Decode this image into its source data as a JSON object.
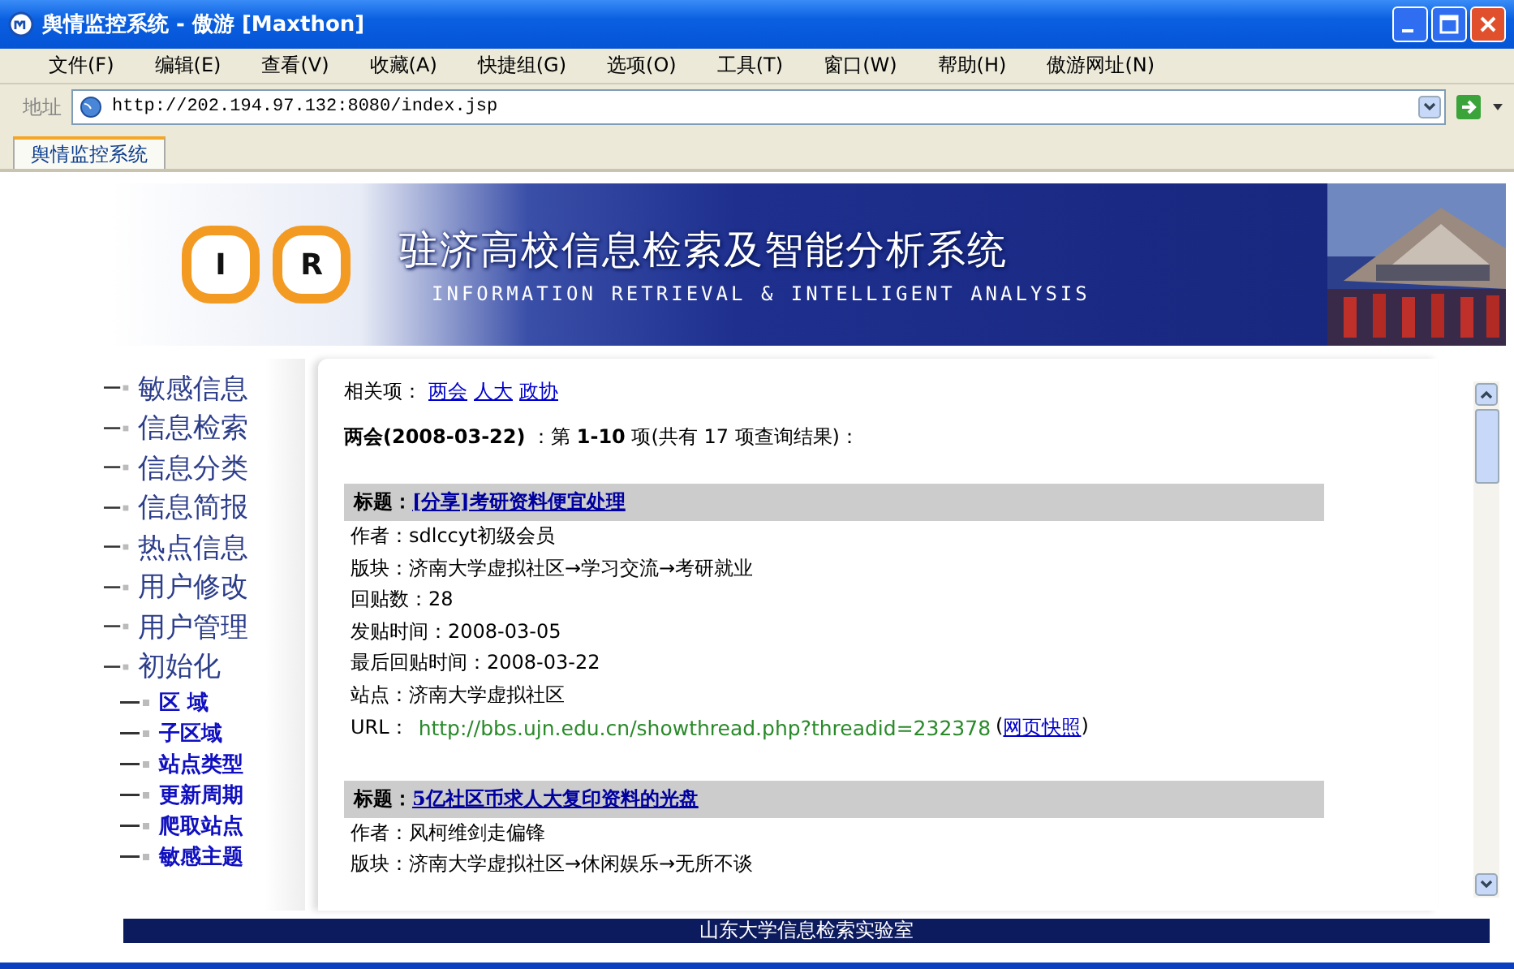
{
  "window": {
    "title": "舆情监控系统 - 傲游 [Maxthon]"
  },
  "menu": [
    "文件(F)",
    "编辑(E)",
    "查看(V)",
    "收藏(A)",
    "快捷组(G)",
    "选项(O)",
    "工具(T)",
    "窗口(W)",
    "帮助(H)",
    "傲游网址(N)"
  ],
  "address_bar": {
    "label": "地址",
    "value": "http://202.194.97.132:8080/index.jsp"
  },
  "tabs": [
    {
      "label": "舆情监控系统",
      "selected": true
    }
  ],
  "banner": {
    "logo_letters": [
      "I",
      "R"
    ],
    "title": "驻济高校信息检索及智能分析系统",
    "subtitle": "INFORMATION RETRIEVAL & INTELLIGENT ANALYSIS"
  },
  "sidebar": {
    "items": [
      {
        "label": "敏感信息",
        "kind": "main"
      },
      {
        "label": "信息检索",
        "kind": "main"
      },
      {
        "label": "信息分类",
        "kind": "main"
      },
      {
        "label": "信息简报",
        "kind": "main"
      },
      {
        "label": "热点信息",
        "kind": "main"
      },
      {
        "label": "用户修改",
        "kind": "main"
      },
      {
        "label": "用户管理",
        "kind": "main"
      },
      {
        "label": "初始化",
        "kind": "main"
      },
      {
        "label": "区  域",
        "kind": "sub"
      },
      {
        "label": "子区域",
        "kind": "sub"
      },
      {
        "label": "站点类型",
        "kind": "sub"
      },
      {
        "label": "更新周期",
        "kind": "sub"
      },
      {
        "label": "爬取站点",
        "kind": "sub"
      },
      {
        "label": "敏感主题",
        "kind": "sub"
      }
    ]
  },
  "related": {
    "label": "相关项：",
    "links": [
      "两会",
      "人大",
      "政协"
    ]
  },
  "summary": "**两会(2008-03-22)** ：第 **1-10** 项(共有  17 项查询结果)：",
  "results": [
    {
      "title_label": "标题：",
      "title": "[分享]考研资料便宜处理",
      "fields": [
        {
          "label": "作者：",
          "value": "sdlccyt初级会员"
        },
        {
          "label": "版块：",
          "value": "济南大学虚拟社区→学习交流→考研就业"
        },
        {
          "label": "回贴数：",
          "value": "28"
        },
        {
          "label": "发贴时间：",
          "value": "2008-03-05"
        },
        {
          "label": "最后回贴时间：",
          "value": "2008-03-22"
        },
        {
          "label": "站点：",
          "value": "济南大学虚拟社区"
        }
      ],
      "url_label": "URL：",
      "url": "http://bbs.ujn.edu.cn/showthread.php?threadid=232378",
      "snapshot": "网页快照",
      "snapshot_brackets": [
        "(",
        ")"
      ]
    },
    {
      "title_label": "标题：",
      "title": "5亿社区币求人大复印资料的光盘",
      "fields": [
        {
          "label": "作者：",
          "value": "风柯维剑走偏锋"
        },
        {
          "label": "版块：",
          "value": "济南大学虚拟社区→休闲娱乐→无所不谈"
        }
      ]
    }
  ],
  "footer": "山东大学信息检索实验室"
}
